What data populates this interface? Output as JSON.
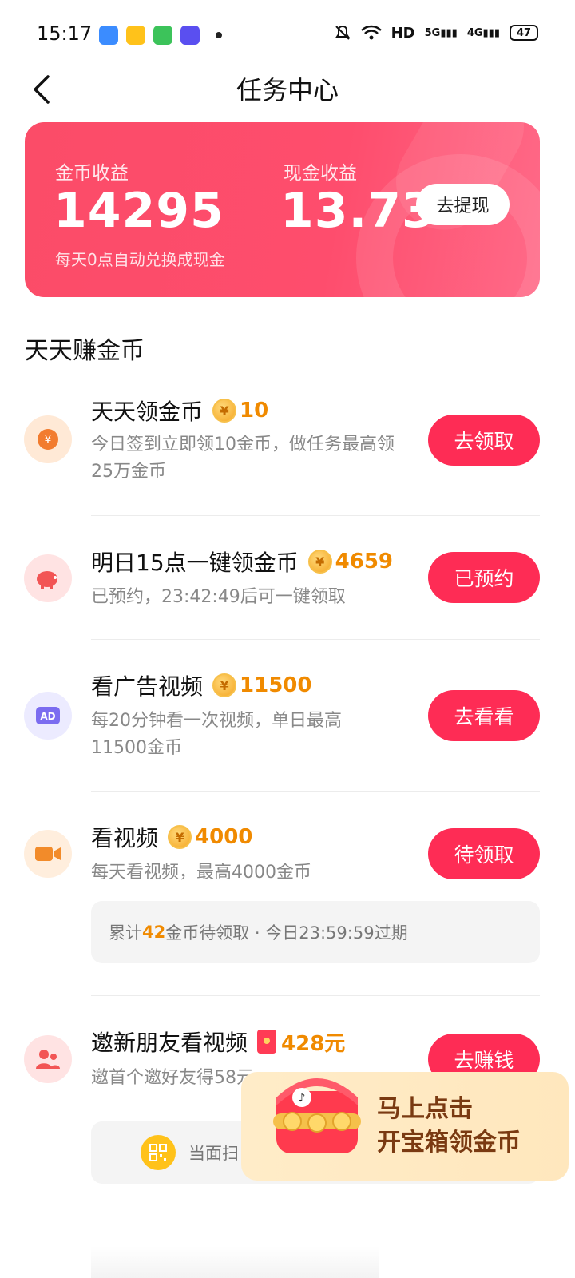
{
  "status_bar": {
    "time": "15:17",
    "network": "HD",
    "signal1": "5G",
    "signal2": "4G",
    "battery": "47"
  },
  "nav": {
    "title": "任务中心"
  },
  "earnings": {
    "coin_label": "金币收益",
    "coin_value": "14295",
    "cash_label": "现金收益",
    "cash_value": "13.73",
    "withdraw_label": "去提现",
    "note": "每天0点自动兑换成现金"
  },
  "section_title": "天天赚金币",
  "tasks": [
    {
      "title": "天天领金币",
      "reward": "10",
      "desc": "今日签到立即领10金币，做任务最高领25万金币",
      "button": "去领取",
      "icon": "yen-coin-icon",
      "icon_color": "#f27c2f"
    },
    {
      "title": "明日15点一键领金币",
      "reward": "4659",
      "desc": "已预约，23:42:49后可一键领取",
      "button": "已预约",
      "icon": "piggy-bank-icon",
      "icon_color": "#f25555"
    },
    {
      "title": "看广告视频",
      "reward": "11500",
      "desc": "每20分钟看一次视频，单日最高11500金币",
      "button": "去看看",
      "icon": "ad-icon",
      "icon_color": "#7b6cf0"
    },
    {
      "title": "看视频",
      "reward": "4000",
      "desc": "每天看视频，最高4000金币",
      "button": "待领取",
      "icon": "video-camera-icon",
      "icon_color": "#f28b2a",
      "pending_prefix": "累计",
      "pending_count": "42",
      "pending_suffix": "金币待领取 · 今日23:59:59过期"
    },
    {
      "title": "邀新朋友看视频",
      "reward": "428元",
      "desc": "邀首个邀好友得58元",
      "button": "去赚钱",
      "icon": "invite-friends-icon",
      "icon_color": "#f25555",
      "sub_text": "当面扫"
    }
  ],
  "treasure": {
    "line1": "马上点击",
    "line2": "开宝箱领金币"
  },
  "colors": {
    "accent": "#fe2c55",
    "gold": "#f08a00"
  }
}
